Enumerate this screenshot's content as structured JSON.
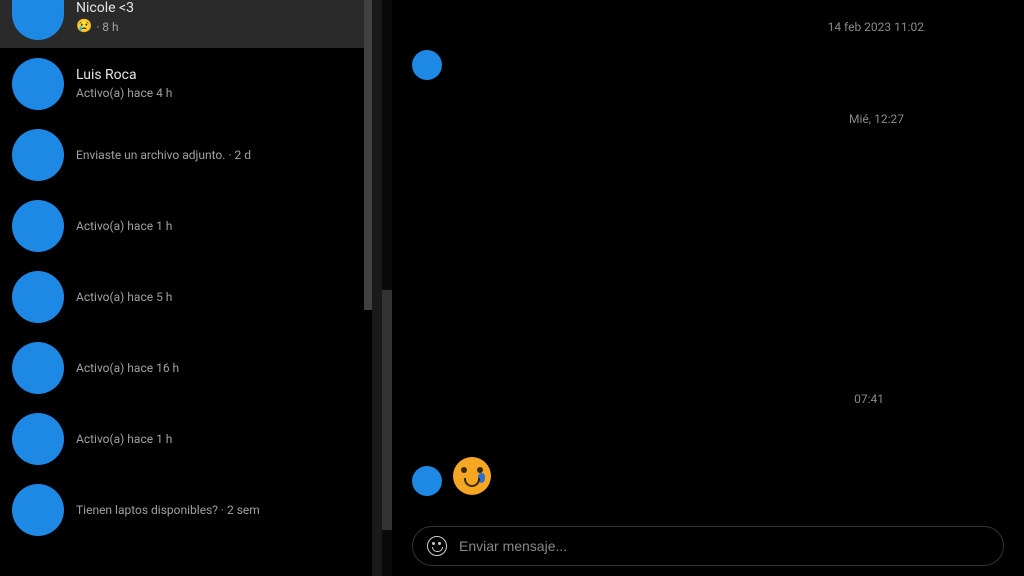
{
  "sidebar": {
    "items": [
      {
        "name": "Nicole <3",
        "preview_emoji": "😢",
        "preview_text": "· 8 h",
        "selected": true,
        "truncated_top": true
      },
      {
        "name": "Luis Roca",
        "preview_text": "Activo(a) hace 4 h",
        "selected": false
      },
      {
        "name": "",
        "preview_text": "Enviaste un archivo adjunto. · 2 d",
        "selected": false
      },
      {
        "name": "",
        "preview_text": "Activo(a) hace 1 h",
        "selected": false
      },
      {
        "name": "",
        "preview_text": "Activo(a) hace 5 h",
        "selected": false
      },
      {
        "name": "",
        "preview_text": "Activo(a) hace 16 h",
        "selected": false
      },
      {
        "name": "",
        "preview_text": "Activo(a) hace 1 h",
        "selected": false
      },
      {
        "name": "",
        "preview_text": "Tienen laptos disponibles? · 2 sem",
        "selected": false
      }
    ]
  },
  "chat": {
    "timestamps": {
      "t1": "14 feb 2023 11:02",
      "t2": "Mié, 12:27",
      "t3": "07:41"
    },
    "emoji_name": "crying-face",
    "input_placeholder": "Enviar mensaje..."
  },
  "colors": {
    "avatar": "#1e88e5",
    "selected_bg": "#2a2a2a"
  }
}
